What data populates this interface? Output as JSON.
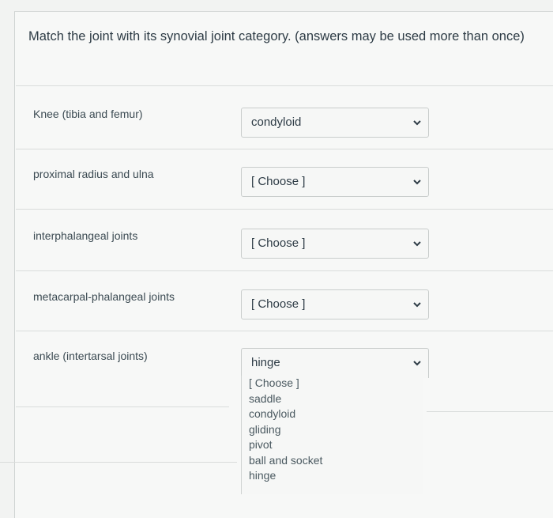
{
  "question": "Match the joint with its synovial joint category. (answers may be used more than once)",
  "rows": [
    {
      "prompt": "Knee (tibia and femur)",
      "selected": "condyloid"
    },
    {
      "prompt": "proximal radius and ulna",
      "selected": "[ Choose ]"
    },
    {
      "prompt": "interphalangeal joints",
      "selected": "[ Choose ]"
    },
    {
      "prompt": "metacarpal-phalangeal joints",
      "selected": "[ Choose ]"
    },
    {
      "prompt": "ankle (intertarsal joints)",
      "selected": "hinge"
    }
  ],
  "dropdown_options": [
    "[ Choose ]",
    "saddle",
    "condyloid",
    "gliding",
    "pivot",
    "ball and socket",
    "hinge"
  ],
  "icons": {
    "chevron": "chevron-down-icon"
  }
}
